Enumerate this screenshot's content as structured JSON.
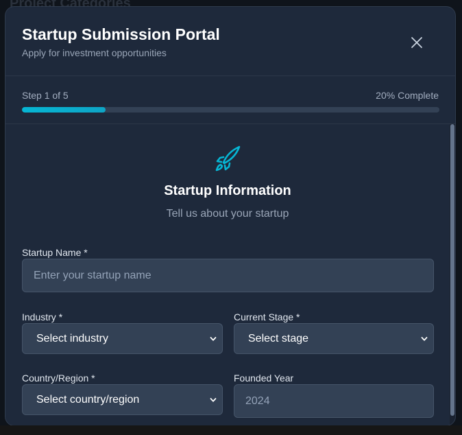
{
  "background": {
    "title": "Project Categories"
  },
  "modal": {
    "title": "Startup Submission Portal",
    "subtitle": "Apply for investment opportunities",
    "close_icon": "close-icon"
  },
  "progress": {
    "step_label": "Step 1 of 5",
    "percent_label": "20% Complete",
    "fraction": 0.2,
    "accent_color": "#06b6d4"
  },
  "section": {
    "icon": "rocket-icon",
    "title": "Startup Information",
    "subtitle": "Tell us about your startup"
  },
  "form": {
    "startup_name": {
      "label": "Startup Name *",
      "placeholder": "Enter your startup name",
      "value": ""
    },
    "industry": {
      "label": "Industry *",
      "selected": "Select industry"
    },
    "stage": {
      "label": "Current Stage *",
      "selected": "Select stage"
    },
    "country": {
      "label": "Country/Region *",
      "selected": "Select country/region"
    },
    "founded_year": {
      "label": "Founded Year",
      "placeholder": "2024",
      "value": ""
    }
  }
}
